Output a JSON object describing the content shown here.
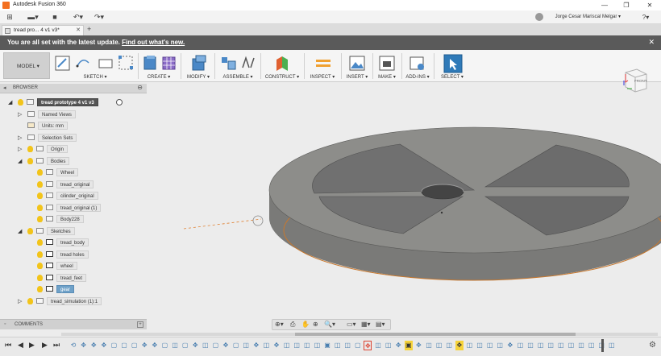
{
  "window": {
    "title": "Autodesk Fusion 360",
    "minimize": "—",
    "maximize": "❐",
    "close": "✕"
  },
  "qat": {
    "grid_icon": "⊞",
    "file_icon": "▬▾",
    "save_icon": "■",
    "undo_icon": "↶▾",
    "redo_icon": "↷▾",
    "user": "Jorge Cesar Mariscal Melgar ▾",
    "help_icon": "?▾"
  },
  "tabs": {
    "doc_tab": "tread pro... 4 v1 v3*",
    "close": "✕",
    "new_tab": "+"
  },
  "banner": {
    "message": "You are all set with the latest update.",
    "link": "Find out what's new.",
    "close": "✕"
  },
  "toolbar": {
    "workspace": "MODEL ▾",
    "groups": [
      {
        "label": "SKETCH ▾"
      },
      {
        "label": "CREATE ▾"
      },
      {
        "label": "MODIFY ▾"
      },
      {
        "label": "ASSEMBLE ▾"
      },
      {
        "label": "CONSTRUCT ▾"
      },
      {
        "label": "INSPECT ▾"
      },
      {
        "label": "INSERT ▾"
      },
      {
        "label": "MAKE ▾"
      },
      {
        "label": "ADD-INS ▾"
      },
      {
        "label": "SELECT ▾"
      }
    ],
    "colors": {
      "accent_blue": "#4a88c7",
      "purple": "#8a6bc7",
      "green": "#4caf50",
      "orange": "#f0a030"
    }
  },
  "viewcube": {
    "face": "FRONT"
  },
  "browser": {
    "header": "BROWSER",
    "tree": [
      {
        "label": "tread prototype 4 v1 v3",
        "indent": 0,
        "arrow": "◢",
        "kind": "root"
      },
      {
        "label": "Named Views",
        "indent": 1,
        "arrow": "▷",
        "kind": "folder"
      },
      {
        "label": "Units: mm",
        "indent": 1,
        "arrow": "",
        "kind": "doc"
      },
      {
        "label": "Selection Sets",
        "indent": 1,
        "arrow": "▷",
        "kind": "folder"
      },
      {
        "label": "Origin",
        "indent": 1,
        "arrow": "▷",
        "kind": "bulb-folder"
      },
      {
        "label": "Bodies",
        "indent": 1,
        "arrow": "◢",
        "kind": "bulb-folder"
      },
      {
        "label": "Wheel",
        "indent": 2,
        "arrow": "",
        "kind": "bulb-body"
      },
      {
        "label": "tread_original",
        "indent": 2,
        "arrow": "",
        "kind": "bulb-body"
      },
      {
        "label": "cilinder_original",
        "indent": 2,
        "arrow": "",
        "kind": "bulb-body"
      },
      {
        "label": "tread_original (1)",
        "indent": 2,
        "arrow": "",
        "kind": "bulb-body"
      },
      {
        "label": "Body228",
        "indent": 2,
        "arrow": "",
        "kind": "bulb-body"
      },
      {
        "label": "Sketches",
        "indent": 1,
        "arrow": "◢",
        "kind": "bulb-folder"
      },
      {
        "label": "tread_body",
        "indent": 2,
        "arrow": "",
        "kind": "bulb-sketch"
      },
      {
        "label": "tread holes",
        "indent": 2,
        "arrow": "",
        "kind": "bulb-sketch"
      },
      {
        "label": "wheel",
        "indent": 2,
        "arrow": "",
        "kind": "bulb-sketch"
      },
      {
        "label": "tread_feet",
        "indent": 2,
        "arrow": "",
        "kind": "bulb-sketch"
      },
      {
        "label": "gear",
        "indent": 2,
        "arrow": "",
        "kind": "bulb-sketch",
        "selected": true
      },
      {
        "label": "tread_simulation (1):1",
        "indent": 1,
        "arrow": "▷",
        "kind": "bulb-comp"
      }
    ]
  },
  "comments": {
    "label": "COMMENTS",
    "add": "+"
  },
  "navbar": {
    "icons": [
      "⊕▾",
      "⎙",
      "✋",
      "⊕",
      "🔍▾",
      "▭▾",
      "▦▾",
      "▤▾"
    ]
  },
  "timeline": {
    "controls": [
      "⏮",
      "◀",
      "▶",
      "▶",
      "⏭"
    ],
    "settings_icon": "⚙"
  }
}
